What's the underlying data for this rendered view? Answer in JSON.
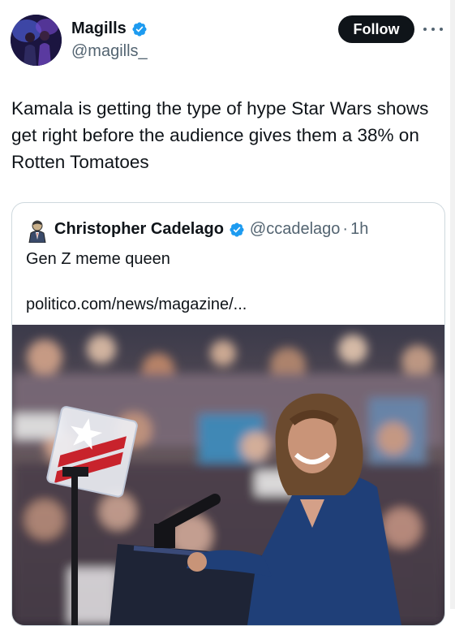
{
  "author": {
    "display_name": "Magills",
    "handle": "@magills_",
    "verified": true,
    "avatar_icon": "profile-avatar"
  },
  "actions": {
    "follow_label": "Follow",
    "more_icon": "more-horizontal-icon"
  },
  "tweet": {
    "text": "Kamala is getting the type of hype Star Wars shows get right before the audience gives them a 38% on Rotten Tomatoes"
  },
  "quoted_tweet": {
    "display_name": "Christopher Cadelago",
    "handle": "@ccadelago",
    "separator": "·",
    "time": "1h",
    "verified": true,
    "text": "Gen Z meme queen",
    "link": "politico.com/news/magazine/...",
    "media_description": "photo-rally-speaker-at-podium"
  },
  "colors": {
    "verified_blue": "#1d9bf0",
    "text_primary": "#0f1419",
    "text_secondary": "#536471",
    "follow_bg": "#0f1419",
    "border": "#cfd9de"
  }
}
